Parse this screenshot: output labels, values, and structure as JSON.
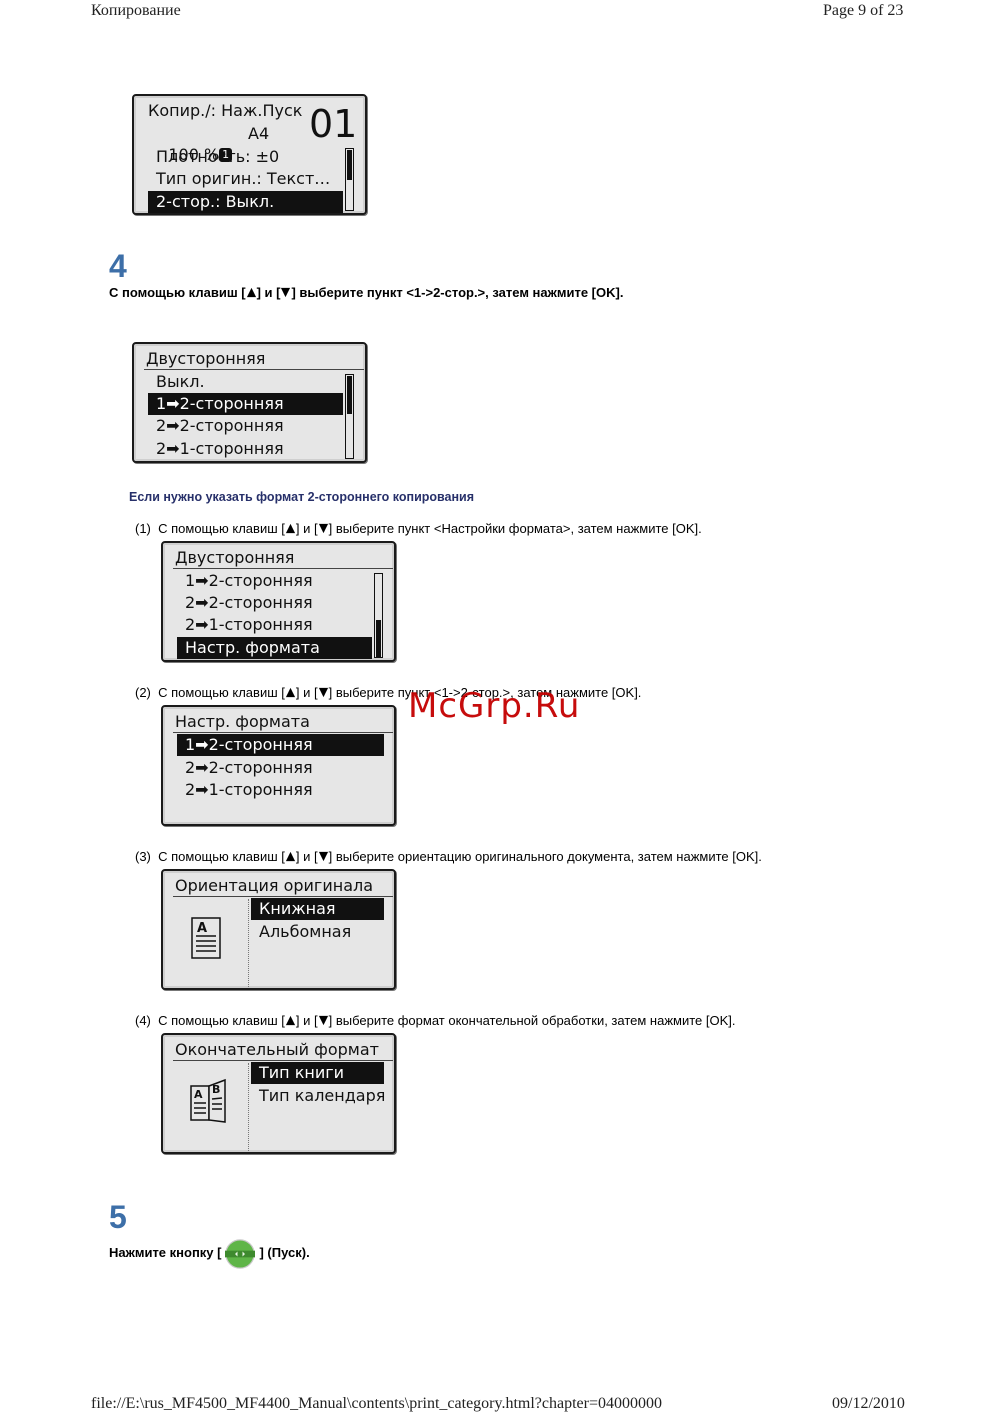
{
  "header": {
    "title": "Копирование",
    "page": "Page 9 of 23"
  },
  "footer": {
    "path": "file://E:\\rus_MF4500_MF4400_Manual\\contents\\print_category.html?chapter=04000000",
    "date": "09/12/2010"
  },
  "screen1": {
    "line1": "Копир./: Наж.Пуск",
    "ratio": "100 %",
    "badge": "1",
    "paper": "A4",
    "count": "01",
    "items": [
      "Плотность: ±0",
      "Тип оригин.: Текст…",
      "2-стор.: Выкл."
    ]
  },
  "step4": {
    "number": "4",
    "pre": "С помощью клавиш [",
    "mid": "] и [",
    "post": "] выберите пункт <1->2-стор.>, затем нажмите [OK]."
  },
  "screen2": {
    "title": "Двусторонняя",
    "items": [
      "Выкл.",
      "1➡2-сторонняя",
      "2➡2-сторонняя",
      "2➡1-сторонняя"
    ]
  },
  "subheading": "Если нужно указать формат 2-стороннего копирования",
  "substeps": [
    {
      "num": "(1)",
      "pre": "С помощью клавиш [",
      "mid": "] и [",
      "post": "] выберите пункт <Настройки формата>, затем нажмите [OK]."
    },
    {
      "num": "(2)",
      "pre": "С помощью клавиш [",
      "mid": "] и [",
      "post": "] выберите пункт <1->2-стор.>, затем нажмите [OK]."
    },
    {
      "num": "(3)",
      "pre": "С помощью клавиш [",
      "mid": "] и [",
      "post": "] выберите ориентацию оригинального документа, затем нажмите [OK]."
    },
    {
      "num": "(4)",
      "pre": "С помощью клавиш [",
      "mid": "] и [",
      "post": "] выберите формат окончательной обработки, затем нажмите [OK]."
    }
  ],
  "screen3": {
    "title": "Двусторонняя",
    "items": [
      "1➡2-сторонняя",
      "2➡2-сторонняя",
      "2➡1-сторонняя",
      "Настр. формата"
    ]
  },
  "screen4": {
    "title": "Настр. формата",
    "items": [
      "1➡2-сторонняя",
      "2➡2-сторонняя",
      "2➡1-сторонняя"
    ]
  },
  "screen5": {
    "title": "Ориентация оригинала",
    "items": [
      "Книжная",
      "Альбомная"
    ],
    "icon_letter": "A"
  },
  "screen6": {
    "title": "Окончательный формат",
    "items": [
      "Тип книги",
      "Тип календаря"
    ],
    "icon_letters": [
      "A",
      "B"
    ]
  },
  "step5": {
    "number": "5",
    "pre": "Нажмите кнопку [",
    "post": "] (Пуск)."
  },
  "watermark": "McGrp.Ru",
  "colors": {
    "step_number": "#3d6fa8",
    "subheading": "#27306a",
    "watermark": "#c40000",
    "start_button": "#5fb548"
  }
}
